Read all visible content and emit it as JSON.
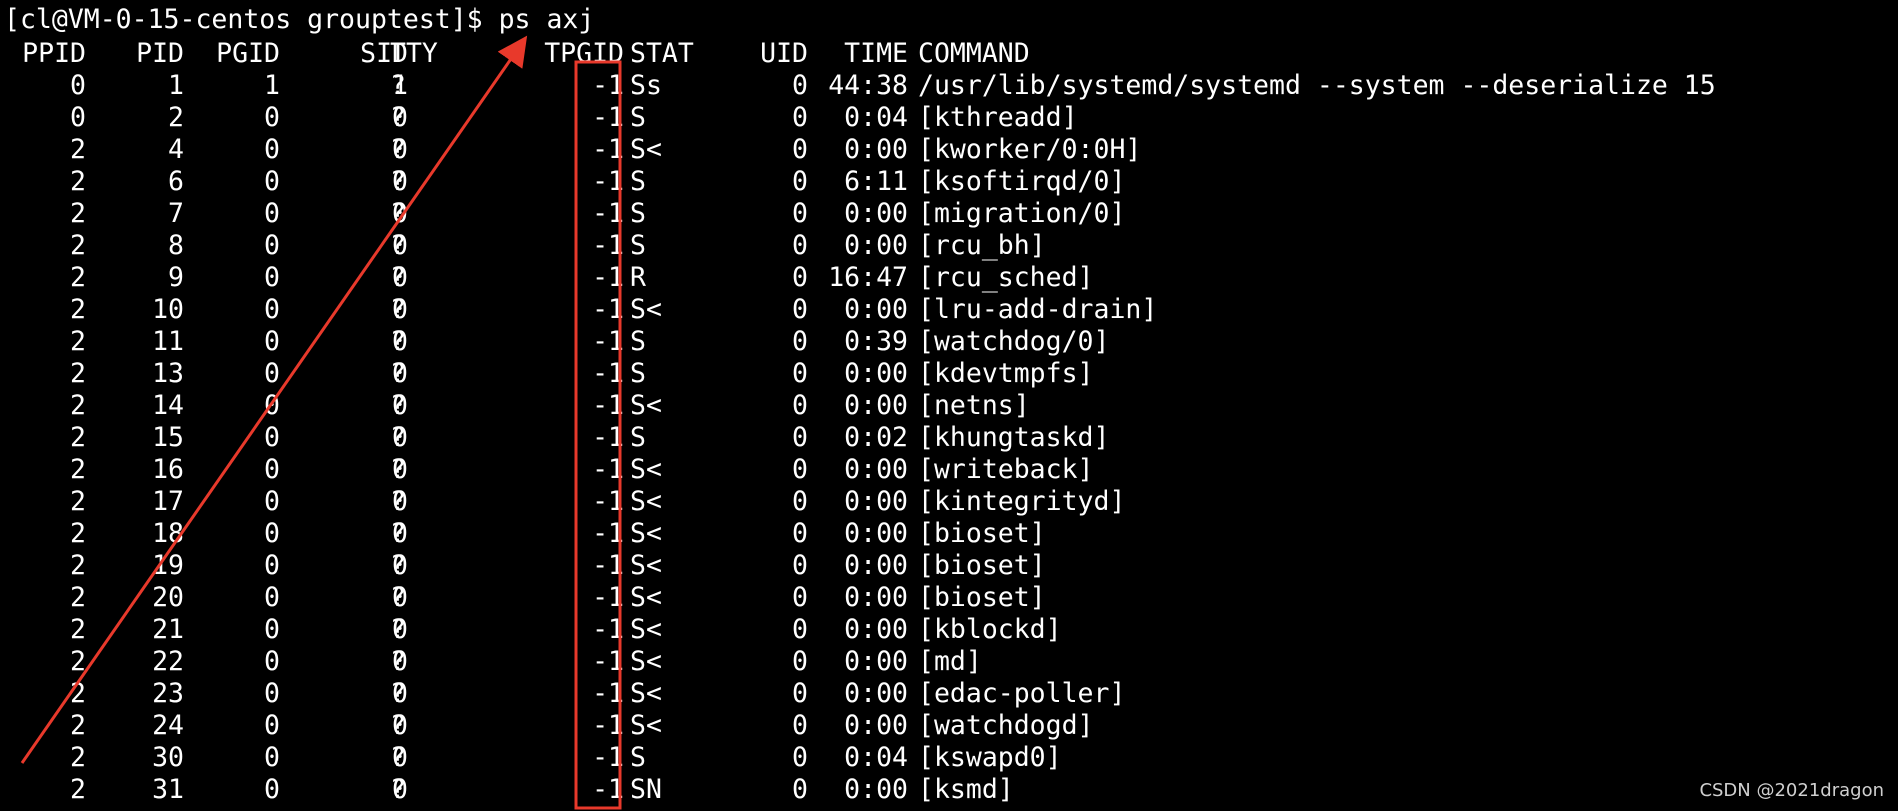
{
  "terminal": {
    "prompt": "[cl@VM-0-15-centos grouptest]$ ps axj",
    "headers": {
      "ppid": "PPID",
      "pid": "PID",
      "pgid": "PGID",
      "sid": "SID",
      "tty": "TTY",
      "tpgid": "TPGID",
      "stat": "STAT",
      "uid": "UID",
      "time": "TIME",
      "command": "COMMAND"
    },
    "rows": [
      {
        "ppid": "0",
        "pid": "1",
        "pgid": "1",
        "sid": "1",
        "tty": "?",
        "tpgid": "-1",
        "stat": "Ss",
        "uid": "0",
        "time": "44:38",
        "command": "/usr/lib/systemd/systemd --system --deserialize 15"
      },
      {
        "ppid": "0",
        "pid": "2",
        "pgid": "0",
        "sid": "0",
        "tty": "?",
        "tpgid": "-1",
        "stat": "S",
        "uid": "0",
        "time": "0:04",
        "command": "[kthreadd]"
      },
      {
        "ppid": "2",
        "pid": "4",
        "pgid": "0",
        "sid": "0",
        "tty": "?",
        "tpgid": "-1",
        "stat": "S<",
        "uid": "0",
        "time": "0:00",
        "command": "[kworker/0:0H]"
      },
      {
        "ppid": "2",
        "pid": "6",
        "pgid": "0",
        "sid": "0",
        "tty": "?",
        "tpgid": "-1",
        "stat": "S",
        "uid": "0",
        "time": "6:11",
        "command": "[ksoftirqd/0]"
      },
      {
        "ppid": "2",
        "pid": "7",
        "pgid": "0",
        "sid": "0",
        "tty": "?",
        "tpgid": "-1",
        "stat": "S",
        "uid": "0",
        "time": "0:00",
        "command": "[migration/0]"
      },
      {
        "ppid": "2",
        "pid": "8",
        "pgid": "0",
        "sid": "0",
        "tty": "?",
        "tpgid": "-1",
        "stat": "S",
        "uid": "0",
        "time": "0:00",
        "command": "[rcu_bh]"
      },
      {
        "ppid": "2",
        "pid": "9",
        "pgid": "0",
        "sid": "0",
        "tty": "?",
        "tpgid": "-1",
        "stat": "R",
        "uid": "0",
        "time": "16:47",
        "command": "[rcu_sched]"
      },
      {
        "ppid": "2",
        "pid": "10",
        "pgid": "0",
        "sid": "0",
        "tty": "?",
        "tpgid": "-1",
        "stat": "S<",
        "uid": "0",
        "time": "0:00",
        "command": "[lru-add-drain]"
      },
      {
        "ppid": "2",
        "pid": "11",
        "pgid": "0",
        "sid": "0",
        "tty": "?",
        "tpgid": "-1",
        "stat": "S",
        "uid": "0",
        "time": "0:39",
        "command": "[watchdog/0]"
      },
      {
        "ppid": "2",
        "pid": "13",
        "pgid": "0",
        "sid": "0",
        "tty": "?",
        "tpgid": "-1",
        "stat": "S",
        "uid": "0",
        "time": "0:00",
        "command": "[kdevtmpfs]"
      },
      {
        "ppid": "2",
        "pid": "14",
        "pgid": "0",
        "sid": "0",
        "tty": "?",
        "tpgid": "-1",
        "stat": "S<",
        "uid": "0",
        "time": "0:00",
        "command": "[netns]"
      },
      {
        "ppid": "2",
        "pid": "15",
        "pgid": "0",
        "sid": "0",
        "tty": "?",
        "tpgid": "-1",
        "stat": "S",
        "uid": "0",
        "time": "0:02",
        "command": "[khungtaskd]"
      },
      {
        "ppid": "2",
        "pid": "16",
        "pgid": "0",
        "sid": "0",
        "tty": "?",
        "tpgid": "-1",
        "stat": "S<",
        "uid": "0",
        "time": "0:00",
        "command": "[writeback]"
      },
      {
        "ppid": "2",
        "pid": "17",
        "pgid": "0",
        "sid": "0",
        "tty": "?",
        "tpgid": "-1",
        "stat": "S<",
        "uid": "0",
        "time": "0:00",
        "command": "[kintegrityd]"
      },
      {
        "ppid": "2",
        "pid": "18",
        "pgid": "0",
        "sid": "0",
        "tty": "?",
        "tpgid": "-1",
        "stat": "S<",
        "uid": "0",
        "time": "0:00",
        "command": "[bioset]"
      },
      {
        "ppid": "2",
        "pid": "19",
        "pgid": "0",
        "sid": "0",
        "tty": "?",
        "tpgid": "-1",
        "stat": "S<",
        "uid": "0",
        "time": "0:00",
        "command": "[bioset]"
      },
      {
        "ppid": "2",
        "pid": "20",
        "pgid": "0",
        "sid": "0",
        "tty": "?",
        "tpgid": "-1",
        "stat": "S<",
        "uid": "0",
        "time": "0:00",
        "command": "[bioset]"
      },
      {
        "ppid": "2",
        "pid": "21",
        "pgid": "0",
        "sid": "0",
        "tty": "?",
        "tpgid": "-1",
        "stat": "S<",
        "uid": "0",
        "time": "0:00",
        "command": "[kblockd]"
      },
      {
        "ppid": "2",
        "pid": "22",
        "pgid": "0",
        "sid": "0",
        "tty": "?",
        "tpgid": "-1",
        "stat": "S<",
        "uid": "0",
        "time": "0:00",
        "command": "[md]"
      },
      {
        "ppid": "2",
        "pid": "23",
        "pgid": "0",
        "sid": "0",
        "tty": "?",
        "tpgid": "-1",
        "stat": "S<",
        "uid": "0",
        "time": "0:00",
        "command": "[edac-poller]"
      },
      {
        "ppid": "2",
        "pid": "24",
        "pgid": "0",
        "sid": "0",
        "tty": "?",
        "tpgid": "-1",
        "stat": "S<",
        "uid": "0",
        "time": "0:00",
        "command": "[watchdogd]"
      },
      {
        "ppid": "2",
        "pid": "30",
        "pgid": "0",
        "sid": "0",
        "tty": "?",
        "tpgid": "-1",
        "stat": "S",
        "uid": "0",
        "time": "0:04",
        "command": "[kswapd0]"
      },
      {
        "ppid": "2",
        "pid": "31",
        "pgid": "0",
        "sid": "0",
        "tty": "?",
        "tpgid": "-1",
        "stat": "SN",
        "uid": "0",
        "time": "0:00",
        "command": "[ksmd]"
      }
    ]
  },
  "annotations": {
    "highlight_color": "#e8392b",
    "highlight_target": "TPGID column",
    "arrow_icon": "red-arrow-icon"
  },
  "watermark": "CSDN @2021dragon",
  "colors": {
    "background": "#000000",
    "text": "#ffffff"
  }
}
